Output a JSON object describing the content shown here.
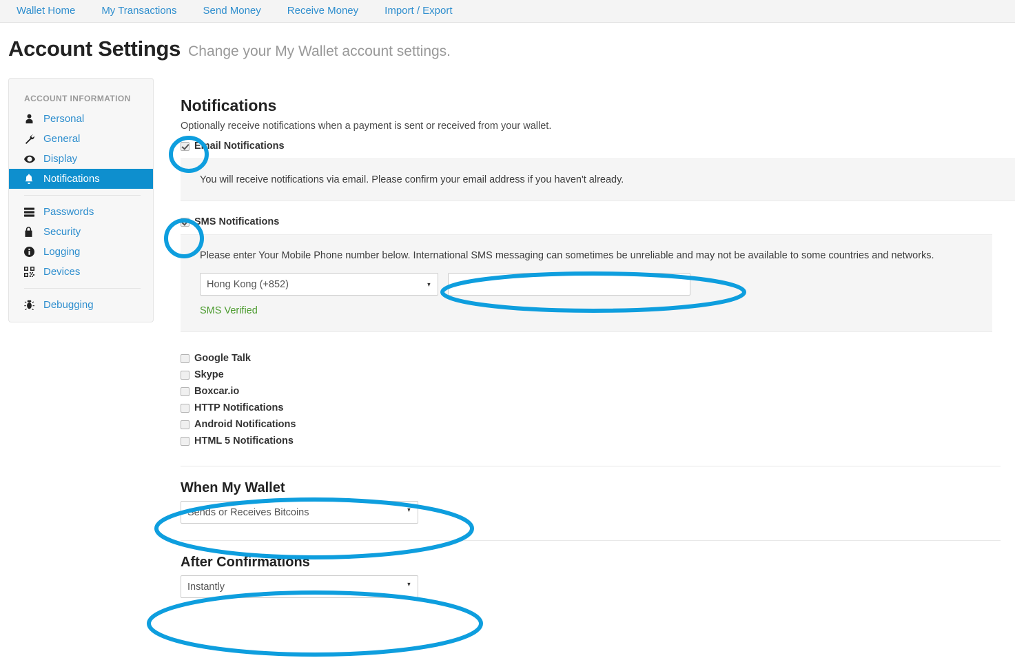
{
  "nav": {
    "items": [
      {
        "label": "Wallet Home"
      },
      {
        "label": "My Transactions"
      },
      {
        "label": "Send Money"
      },
      {
        "label": "Receive Money"
      },
      {
        "label": "Import / Export"
      }
    ]
  },
  "header": {
    "title": "Account Settings",
    "subtitle": "Change your My Wallet account settings."
  },
  "sidebar": {
    "heading": "ACCOUNT INFORMATION",
    "group1": [
      {
        "label": "Personal",
        "icon": "person-icon",
        "active": false
      },
      {
        "label": "General",
        "icon": "wrench-icon",
        "active": false
      },
      {
        "label": "Display",
        "icon": "eye-icon",
        "active": false
      },
      {
        "label": "Notifications",
        "icon": "bell-icon",
        "active": true
      }
    ],
    "group2": [
      {
        "label": "Passwords",
        "icon": "server-icon",
        "active": false
      },
      {
        "label": "Security",
        "icon": "lock-icon",
        "active": false
      },
      {
        "label": "Logging",
        "icon": "info-icon",
        "active": false
      },
      {
        "label": "Devices",
        "icon": "qrcode-icon",
        "active": false
      }
    ],
    "group3": [
      {
        "label": "Debugging",
        "icon": "bug-icon",
        "active": false
      }
    ]
  },
  "main": {
    "section_title": "Notifications",
    "section_desc": "Optionally receive notifications when a payment is sent or received from your wallet.",
    "email": {
      "label": "Email Notifications",
      "checked": true,
      "panel_text": "You will receive notifications via email. Please confirm your email address if you haven't already."
    },
    "sms": {
      "label": "SMS Notifications",
      "checked": true,
      "panel_text": "Please enter Your Mobile Phone number below. International SMS messaging can sometimes be unreliable and may not be available to some countries and networks.",
      "country_value": "Hong Kong (+852)",
      "country_options": [
        "Hong Kong (+852)"
      ],
      "phone_value": "",
      "phone_placeholder": "",
      "verified_text": "SMS Verified",
      "verified_color": "#4b9b2e"
    },
    "services": [
      {
        "label": "Google Talk",
        "checked": false
      },
      {
        "label": "Skype",
        "checked": false
      },
      {
        "label": "Boxcar.io",
        "checked": false
      },
      {
        "label": "HTTP Notifications",
        "checked": false
      },
      {
        "label": "Android Notifications",
        "checked": false
      },
      {
        "label": "HTML 5 Notifications",
        "checked": false
      }
    ],
    "when_my_wallet": {
      "title": "When My Wallet",
      "value": "Sends or Receives Bitcoins",
      "options": [
        "Sends or Receives Bitcoins"
      ]
    },
    "after_confirmations": {
      "title": "After Confirmations",
      "value": "Instantly",
      "options": [
        "Instantly"
      ]
    }
  },
  "annotations": {
    "color": "#0e9ede",
    "shapes": [
      {
        "name": "email-checkbox-highlight"
      },
      {
        "name": "sms-checkbox-highlight"
      },
      {
        "name": "phone-input-highlight"
      },
      {
        "name": "when-my-wallet-highlight"
      },
      {
        "name": "after-confirmations-highlight"
      }
    ]
  }
}
